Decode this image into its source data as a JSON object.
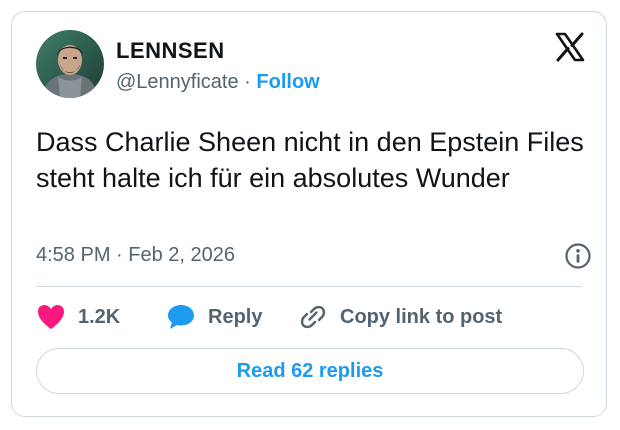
{
  "author": {
    "display_name": "LENNSEN",
    "handle": "@Lennyficate",
    "separator": "·",
    "follow_label": "Follow"
  },
  "tweet": {
    "text": "Dass Charlie Sheen nicht in den Epstein Files steht halte ich für ein absolutes Wunder",
    "time": "4:58 PM",
    "separator": "·",
    "date": "Feb 2, 2026"
  },
  "actions": {
    "likes": "1.2K",
    "reply_label": "Reply",
    "copy_link_label": "Copy link to post"
  },
  "read_replies_label": "Read 62 replies",
  "icons": {
    "logo": "x-logo-icon",
    "info": "info-icon",
    "like": "heart-icon",
    "reply": "speech-bubble-icon",
    "copy": "link-icon"
  },
  "colors": {
    "accent": "#1d9bf0",
    "like": "#f91880",
    "text": "#0f1419",
    "muted": "#536471",
    "border": "#cfd9de"
  }
}
